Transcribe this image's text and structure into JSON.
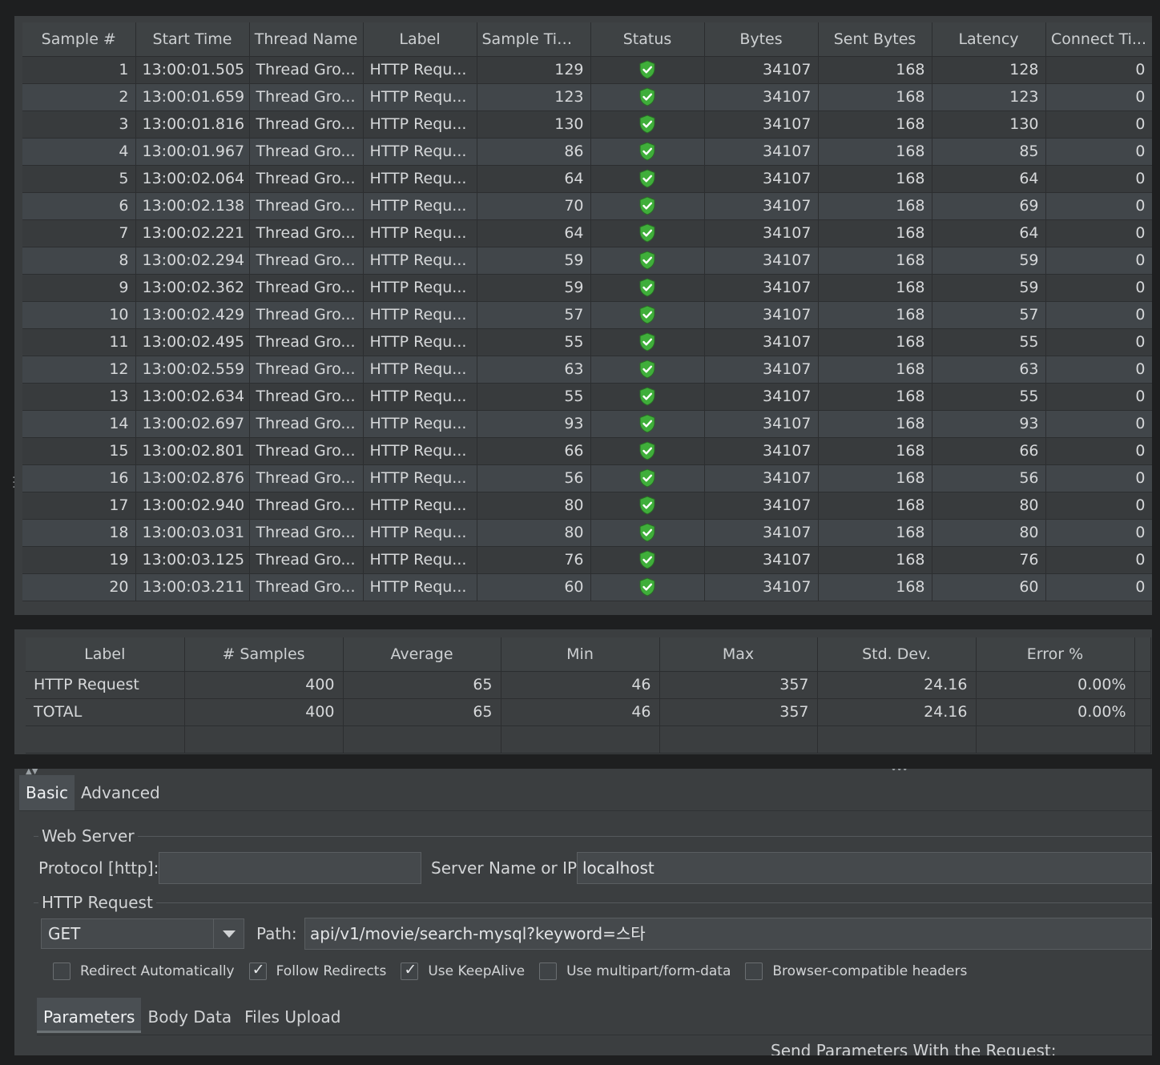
{
  "results": {
    "columns": [
      "Sample #",
      "Start Time",
      "Thread Name",
      "Label",
      "Sample Tim...",
      "Status",
      "Bytes",
      "Sent Bytes",
      "Latency",
      "Connect Ti..."
    ],
    "rows": [
      [
        "1",
        "13:00:01.505",
        "Thread Gro...",
        "HTTP Requ...",
        "129",
        "success",
        "34107",
        "168",
        "128",
        "0"
      ],
      [
        "2",
        "13:00:01.659",
        "Thread Gro...",
        "HTTP Requ...",
        "123",
        "success",
        "34107",
        "168",
        "123",
        "0"
      ],
      [
        "3",
        "13:00:01.816",
        "Thread Gro...",
        "HTTP Requ...",
        "130",
        "success",
        "34107",
        "168",
        "130",
        "0"
      ],
      [
        "4",
        "13:00:01.967",
        "Thread Gro...",
        "HTTP Requ...",
        "86",
        "success",
        "34107",
        "168",
        "85",
        "0"
      ],
      [
        "5",
        "13:00:02.064",
        "Thread Gro...",
        "HTTP Requ...",
        "64",
        "success",
        "34107",
        "168",
        "64",
        "0"
      ],
      [
        "6",
        "13:00:02.138",
        "Thread Gro...",
        "HTTP Requ...",
        "70",
        "success",
        "34107",
        "168",
        "69",
        "0"
      ],
      [
        "7",
        "13:00:02.221",
        "Thread Gro...",
        "HTTP Requ...",
        "64",
        "success",
        "34107",
        "168",
        "64",
        "0"
      ],
      [
        "8",
        "13:00:02.294",
        "Thread Gro...",
        "HTTP Requ...",
        "59",
        "success",
        "34107",
        "168",
        "59",
        "0"
      ],
      [
        "9",
        "13:00:02.362",
        "Thread Gro...",
        "HTTP Requ...",
        "59",
        "success",
        "34107",
        "168",
        "59",
        "0"
      ],
      [
        "10",
        "13:00:02.429",
        "Thread Gro...",
        "HTTP Requ...",
        "57",
        "success",
        "34107",
        "168",
        "57",
        "0"
      ],
      [
        "11",
        "13:00:02.495",
        "Thread Gro...",
        "HTTP Requ...",
        "55",
        "success",
        "34107",
        "168",
        "55",
        "0"
      ],
      [
        "12",
        "13:00:02.559",
        "Thread Gro...",
        "HTTP Requ...",
        "63",
        "success",
        "34107",
        "168",
        "63",
        "0"
      ],
      [
        "13",
        "13:00:02.634",
        "Thread Gro...",
        "HTTP Requ...",
        "55",
        "success",
        "34107",
        "168",
        "55",
        "0"
      ],
      [
        "14",
        "13:00:02.697",
        "Thread Gro...",
        "HTTP Requ...",
        "93",
        "success",
        "34107",
        "168",
        "93",
        "0"
      ],
      [
        "15",
        "13:00:02.801",
        "Thread Gro...",
        "HTTP Requ...",
        "66",
        "success",
        "34107",
        "168",
        "66",
        "0"
      ],
      [
        "16",
        "13:00:02.876",
        "Thread Gro...",
        "HTTP Requ...",
        "56",
        "success",
        "34107",
        "168",
        "56",
        "0"
      ],
      [
        "17",
        "13:00:02.940",
        "Thread Gro...",
        "HTTP Requ...",
        "80",
        "success",
        "34107",
        "168",
        "80",
        "0"
      ],
      [
        "18",
        "13:00:03.031",
        "Thread Gro...",
        "HTTP Requ...",
        "80",
        "success",
        "34107",
        "168",
        "80",
        "0"
      ],
      [
        "19",
        "13:00:03.125",
        "Thread Gro...",
        "HTTP Requ...",
        "76",
        "success",
        "34107",
        "168",
        "76",
        "0"
      ],
      [
        "20",
        "13:00:03.211",
        "Thread Gro...",
        "HTTP Requ...",
        "60",
        "success",
        "34107",
        "168",
        "60",
        "0"
      ]
    ]
  },
  "summary": {
    "columns": [
      "Label",
      "# Samples",
      "Average",
      "Min",
      "Max",
      "Std. Dev.",
      "Error %"
    ],
    "rows": [
      [
        "HTTP Request",
        "400",
        "65",
        "46",
        "357",
        "24.16",
        "0.00%"
      ],
      [
        "TOTAL",
        "400",
        "65",
        "46",
        "357",
        "24.16",
        "0.00%"
      ]
    ]
  },
  "config": {
    "tabs": [
      "Basic",
      "Advanced"
    ],
    "web_server_label": "Web Server",
    "protocol_label": "Protocol [http]:",
    "protocol_value": "",
    "server_label": "Server Name or IP:",
    "server_value": "localhost",
    "http_request_label": "HTTP Request",
    "method": "GET",
    "path_label": "Path:",
    "path_value": "api/v1/movie/search-mysql?keyword=스타",
    "checkboxes": [
      {
        "label": "Redirect Automatically",
        "checked": false
      },
      {
        "label": "Follow Redirects",
        "checked": true
      },
      {
        "label": "Use KeepAlive",
        "checked": true
      },
      {
        "label": "Use multipart/form-data",
        "checked": false
      },
      {
        "label": "Browser-compatible headers",
        "checked": false
      }
    ],
    "subtabs": [
      "Parameters",
      "Body Data",
      "Files Upload"
    ],
    "send_params_label": "Send Parameters With the Request:"
  },
  "colors": {
    "status_success": "#3fae3a",
    "background": "#3b3e40"
  },
  "icons": {
    "status": "shield-check-icon"
  }
}
